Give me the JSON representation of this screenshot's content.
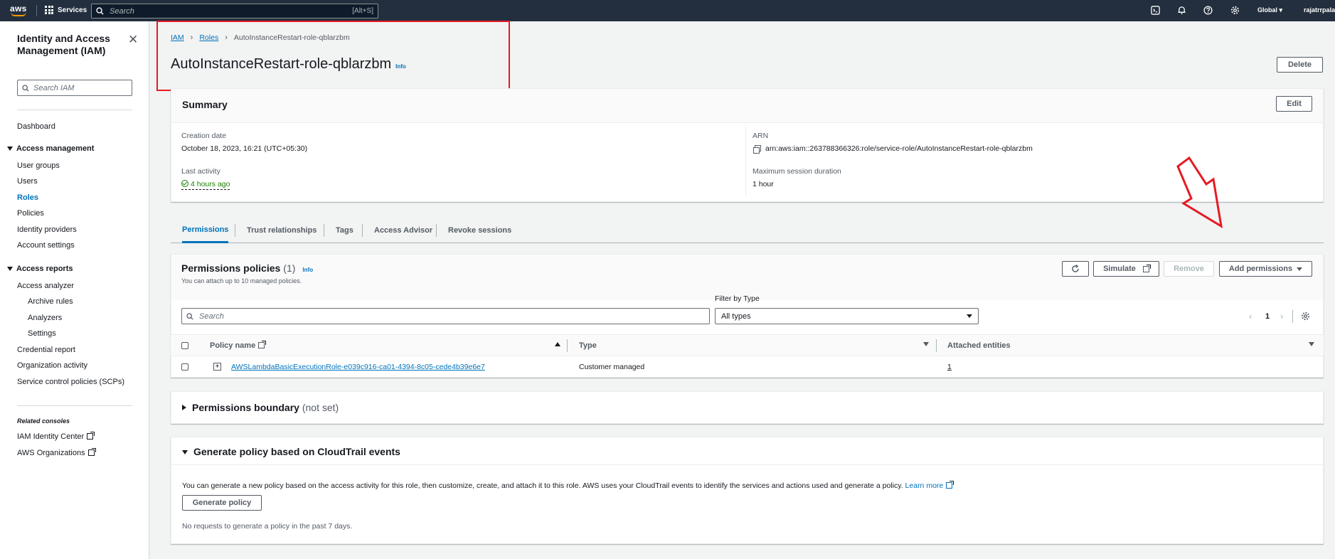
{
  "topnav": {
    "logo": "aws",
    "services_label": "Services",
    "search_placeholder": "Search",
    "search_shortcut": "[Alt+S]",
    "region": "Global",
    "user": "rajatrrpala"
  },
  "sidebar": {
    "title": "Identity and Access Management (IAM)",
    "search_placeholder": "Search IAM",
    "dashboard": "Dashboard",
    "access_management": {
      "label": "Access management",
      "items": [
        "User groups",
        "Users",
        "Roles",
        "Policies",
        "Identity providers",
        "Account settings"
      ]
    },
    "access_reports": {
      "label": "Access reports",
      "items": [
        "Access analyzer",
        "Archive rules",
        "Analyzers",
        "Settings",
        "Credential report",
        "Organization activity",
        "Service control policies (SCPs)"
      ]
    },
    "related_consoles_label": "Related consoles",
    "related": [
      "IAM Identity Center",
      "AWS Organizations"
    ]
  },
  "breadcrumb": {
    "items": [
      "IAM",
      "Roles"
    ],
    "current": "AutoInstanceRestart-role-qblarzbm"
  },
  "page": {
    "title": "AutoInstanceRestart-role-qblarzbm",
    "info": "Info",
    "delete_label": "Delete"
  },
  "summary": {
    "heading": "Summary",
    "edit_label": "Edit",
    "creation_date_label": "Creation date",
    "creation_date": "October 18, 2023, 16:21 (UTC+05:30)",
    "last_activity_label": "Last activity",
    "last_activity": "4 hours ago",
    "arn_label": "ARN",
    "arn": "arn:aws:iam::263788366326:role/service-role/AutoInstanceRestart-role-qblarzbm",
    "max_session_label": "Maximum session duration",
    "max_session": "1 hour"
  },
  "tabs": [
    "Permissions",
    "Trust relationships",
    "Tags",
    "Access Advisor",
    "Revoke sessions"
  ],
  "permissions": {
    "heading": "Permissions policies",
    "count": "(1)",
    "info": "Info",
    "subtext": "You can attach up to 10 managed policies.",
    "simulate_label": "Simulate",
    "remove_label": "Remove",
    "add_label": "Add permissions",
    "filter_label": "Filter by Type",
    "search_placeholder": "Search",
    "filter_value": "All types",
    "page_number": "1",
    "columns": [
      "Policy name",
      "Type",
      "Attached entities"
    ],
    "rows": [
      {
        "name": "AWSLambdaBasicExecutionRole-e039c916-ca01-4394-8c05-cede4b39e6e7",
        "type": "Customer managed",
        "entities": "1"
      }
    ]
  },
  "boundary": {
    "heading": "Permissions boundary",
    "status": "(not set)"
  },
  "generate": {
    "heading": "Generate policy based on CloudTrail events",
    "description": "You can generate a new policy based on the access activity for this role, then customize, create, and attach it to this role. AWS uses your CloudTrail events to identify the services and actions used and generate a policy.",
    "learn_more": "Learn more",
    "button_label": "Generate policy",
    "note": "No requests to generate a policy in the past 7 days."
  },
  "colors": {
    "nav_bg": "#232f3e",
    "link": "#0073bb",
    "annotation_red": "#e41b23",
    "success_green": "#1d8102"
  },
  "annotation": {
    "arrow_icon": "red-outline-arrow-down-icon"
  }
}
